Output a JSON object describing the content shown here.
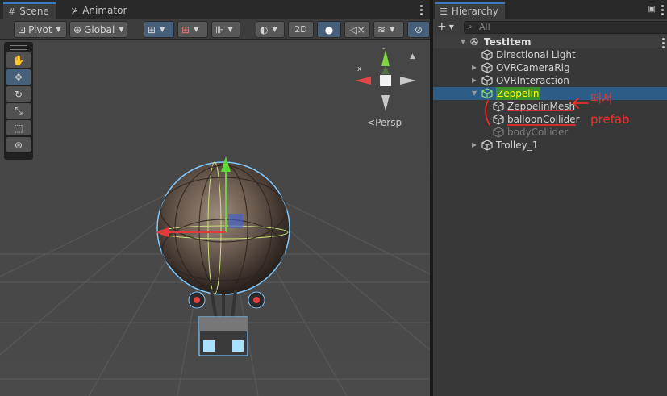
{
  "scene_tabs": [
    {
      "label": "Scene",
      "icon": "hash-grid-icon",
      "active": true
    },
    {
      "label": "Animator",
      "icon": "animator-icon",
      "active": false
    }
  ],
  "toolbar": {
    "pivot_label": "Pivot",
    "global_label": "Global",
    "mode_2d_label": "2D"
  },
  "viewport": {
    "persp_label": "Persp",
    "axis_x_label": "x",
    "axis_y_label": "y",
    "tools": [
      "hand-tool",
      "move-tool",
      "rotate-tool",
      "scale-tool",
      "rect-tool",
      "transform-tool"
    ],
    "active_tool": "move-tool"
  },
  "hierarchy": {
    "tab_label": "Hierarchy",
    "search_placeholder": "All",
    "root": "TestItem",
    "items": [
      {
        "label": "Directional Light",
        "depth": 1,
        "expandable": false,
        "state": "normal"
      },
      {
        "label": "OVRCameraRig",
        "depth": 1,
        "expandable": true,
        "state": "normal"
      },
      {
        "label": "OVRInteraction",
        "depth": 1,
        "expandable": true,
        "state": "normal"
      },
      {
        "label": "Zeppelin",
        "depth": 1,
        "expandable": true,
        "expanded": true,
        "state": "selected"
      },
      {
        "label": "ZeppelinMesh",
        "depth": 2,
        "expandable": false,
        "state": "normal"
      },
      {
        "label": "balloonCollider",
        "depth": 2,
        "expandable": false,
        "state": "normal"
      },
      {
        "label": "bodyCollider",
        "depth": 2,
        "expandable": false,
        "state": "disabled"
      },
      {
        "label": "Trolley_1",
        "depth": 1,
        "expandable": true,
        "state": "normal"
      }
    ]
  },
  "annotation": {
    "line1": "떼서",
    "line2": "prefab",
    "color": "#ff2a2a"
  },
  "colors": {
    "accent": "#3a79bb",
    "selection": "#2c5d87",
    "highlight_bg": "#3c8f2c",
    "highlight_text": "#ffff00"
  }
}
